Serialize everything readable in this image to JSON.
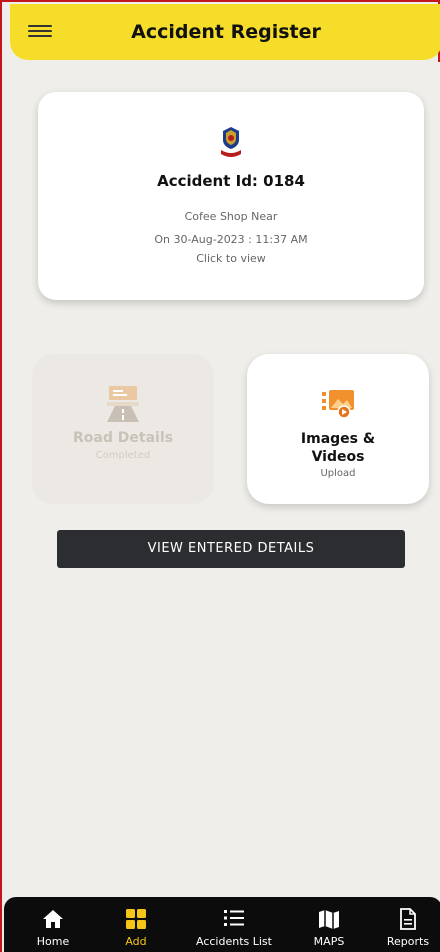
{
  "header": {
    "title": "Accident Register",
    "menu_icon": "hamburger-menu-icon"
  },
  "accident": {
    "id_text": "Accident Id: 0184",
    "location": "Cofee Shop Near",
    "date": "On 30-Aug-2023 : 11:37 AM",
    "hint": "Click to view"
  },
  "tiles": [
    {
      "title": "Road Details",
      "subtitle": "Completed",
      "icon": "road-icon"
    },
    {
      "title_line1": "Images &",
      "title_line2": "Videos",
      "subtitle": "Upload",
      "icon": "image-video-icon"
    }
  ],
  "view_button": "VIEW ENTERED DETAILS",
  "nav": [
    {
      "label": "Home",
      "icon": "home-icon"
    },
    {
      "label": "Add",
      "icon": "grid-icon",
      "active": true
    },
    {
      "label": "Accidents List",
      "icon": "list-icon"
    },
    {
      "label": "MAPS",
      "icon": "map-icon"
    },
    {
      "label": "Reports",
      "icon": "report-icon"
    }
  ],
  "colors": {
    "accent": "#f6dd2a",
    "active_nav": "#f5c518",
    "dark_button": "#2b2d30",
    "frame_border": "#c4161c"
  }
}
